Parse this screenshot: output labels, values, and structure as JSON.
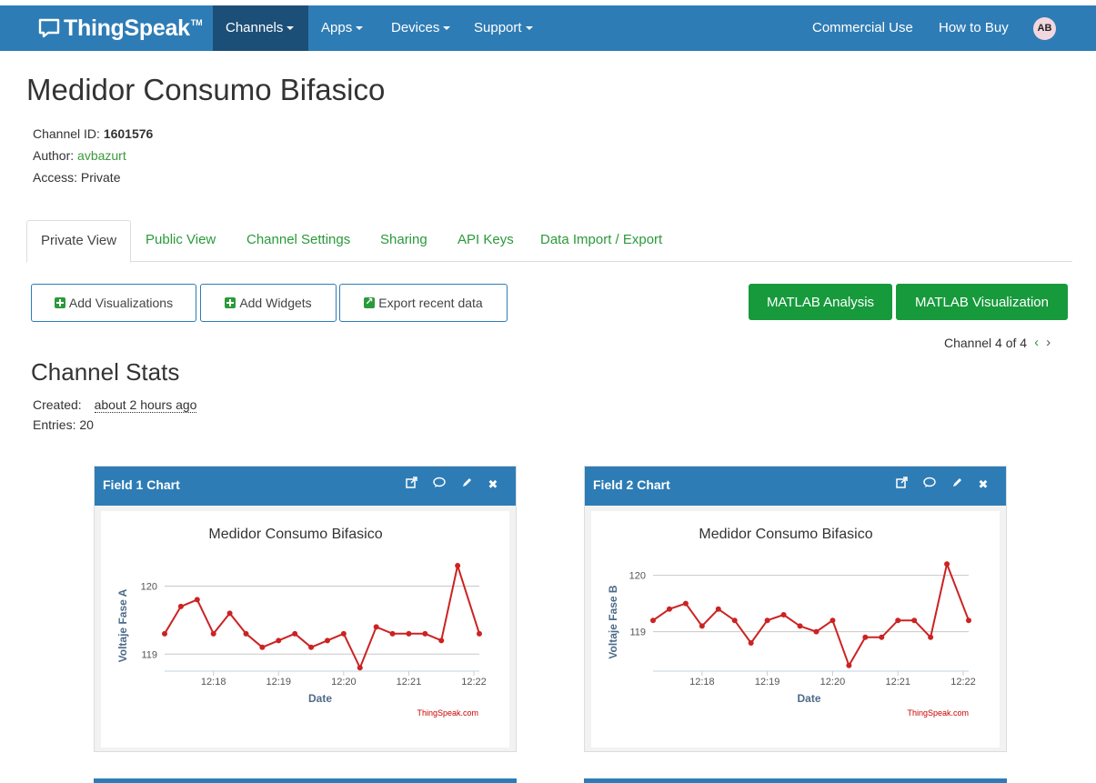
{
  "navbar": {
    "brand": "ThingSpeak",
    "brand_tm": "TM",
    "items": [
      {
        "label": "Channels",
        "active": true,
        "caret": true
      },
      {
        "label": "Apps",
        "active": false,
        "caret": true
      },
      {
        "label": "Devices",
        "active": false,
        "caret": true
      },
      {
        "label": "Support",
        "active": false,
        "caret": true
      }
    ],
    "right_items": [
      "Commercial Use",
      "How to Buy"
    ],
    "avatar_initials": "AB",
    "color": "#2e7cb5"
  },
  "channel": {
    "title": "Medidor Consumo Bifasico",
    "id_label": "Channel ID:",
    "id_value": "1601576",
    "author_label": "Author:",
    "author_value": "avbazurt",
    "access_label": "Access:",
    "access_value": "Private"
  },
  "tabs": [
    {
      "label": "Private View",
      "active": true
    },
    {
      "label": "Public View",
      "active": false
    },
    {
      "label": "Channel Settings",
      "active": false
    },
    {
      "label": "Sharing",
      "active": false
    },
    {
      "label": "API Keys",
      "active": false
    },
    {
      "label": "Data Import / Export",
      "active": false
    }
  ],
  "toolbar": {
    "add_visualizations": "Add Visualizations",
    "add_widgets": "Add Widgets",
    "export_recent": "Export recent data",
    "matlab_analysis": "MATLAB Analysis",
    "matlab_visualization": "MATLAB Visualization"
  },
  "pager": {
    "text": "Channel 4 of 4",
    "prev": "‹",
    "next": "›"
  },
  "stats": {
    "title": "Channel Stats",
    "created_label": "Created:",
    "created_value": "about 2 hours ago",
    "entries_label": "Entries:",
    "entries_value": "20"
  },
  "panels": [
    {
      "title": "Field 1 Chart",
      "tools": [
        "external-link-icon",
        "comment-icon",
        "pencil-icon",
        "close-icon"
      ]
    },
    {
      "title": "Field 2 Chart",
      "tools": [
        "external-link-icon",
        "comment-icon",
        "pencil-icon",
        "close-icon"
      ]
    }
  ],
  "chart_data": [
    {
      "type": "line",
      "title": "Medidor Consumo Bifasico",
      "xlabel": "Date",
      "ylabel": "Voltaje Fase A",
      "credit": "ThingSpeak.com",
      "xticks": [
        "12:18",
        "12:19",
        "12:20",
        "12:21",
        "12:22"
      ],
      "yticks": [
        119,
        120
      ],
      "ylim": [
        118.75,
        120.3
      ],
      "series": [
        {
          "color": "#cc2222",
          "points": [
            [
              "12:17:15",
              119.3
            ],
            [
              "12:17:30",
              119.7
            ],
            [
              "12:17:45",
              119.8
            ],
            [
              "12:18:00",
              119.3
            ],
            [
              "12:18:15",
              119.6
            ],
            [
              "12:18:30",
              119.3
            ],
            [
              "12:18:45",
              119.1
            ],
            [
              "12:19:00",
              119.2
            ],
            [
              "12:19:15",
              119.3
            ],
            [
              "12:19:30",
              119.1
            ],
            [
              "12:19:45",
              119.2
            ],
            [
              "12:20:00",
              119.3
            ],
            [
              "12:20:15",
              118.8
            ],
            [
              "12:20:30",
              119.4
            ],
            [
              "12:20:45",
              119.3
            ],
            [
              "12:21:00",
              119.3
            ],
            [
              "12:21:15",
              119.3
            ],
            [
              "12:21:30",
              119.2
            ],
            [
              "12:21:45",
              120.3
            ],
            [
              "12:22:05",
              119.3
            ]
          ]
        }
      ]
    },
    {
      "type": "line",
      "title": "Medidor Consumo Bifasico",
      "xlabel": "Date",
      "ylabel": "Voltaje Fase B",
      "credit": "ThingSpeak.com",
      "xticks": [
        "12:18",
        "12:19",
        "12:20",
        "12:21",
        "12:22"
      ],
      "yticks": [
        119,
        120
      ],
      "ylim": [
        118.3,
        120.3
      ],
      "series": [
        {
          "color": "#cc2222",
          "points": [
            [
              "12:17:15",
              119.2
            ],
            [
              "12:17:30",
              119.4
            ],
            [
              "12:17:45",
              119.5
            ],
            [
              "12:18:00",
              119.1
            ],
            [
              "12:18:15",
              119.4
            ],
            [
              "12:18:30",
              119.2
            ],
            [
              "12:18:45",
              118.8
            ],
            [
              "12:19:00",
              119.2
            ],
            [
              "12:19:15",
              119.3
            ],
            [
              "12:19:30",
              119.1
            ],
            [
              "12:19:45",
              119.0
            ],
            [
              "12:20:00",
              119.2
            ],
            [
              "12:20:15",
              118.4
            ],
            [
              "12:20:30",
              118.9
            ],
            [
              "12:20:45",
              118.9
            ],
            [
              "12:21:00",
              119.2
            ],
            [
              "12:21:15",
              119.2
            ],
            [
              "12:21:30",
              118.9
            ],
            [
              "12:21:45",
              120.2
            ],
            [
              "12:22:05",
              119.2
            ]
          ]
        }
      ]
    }
  ]
}
